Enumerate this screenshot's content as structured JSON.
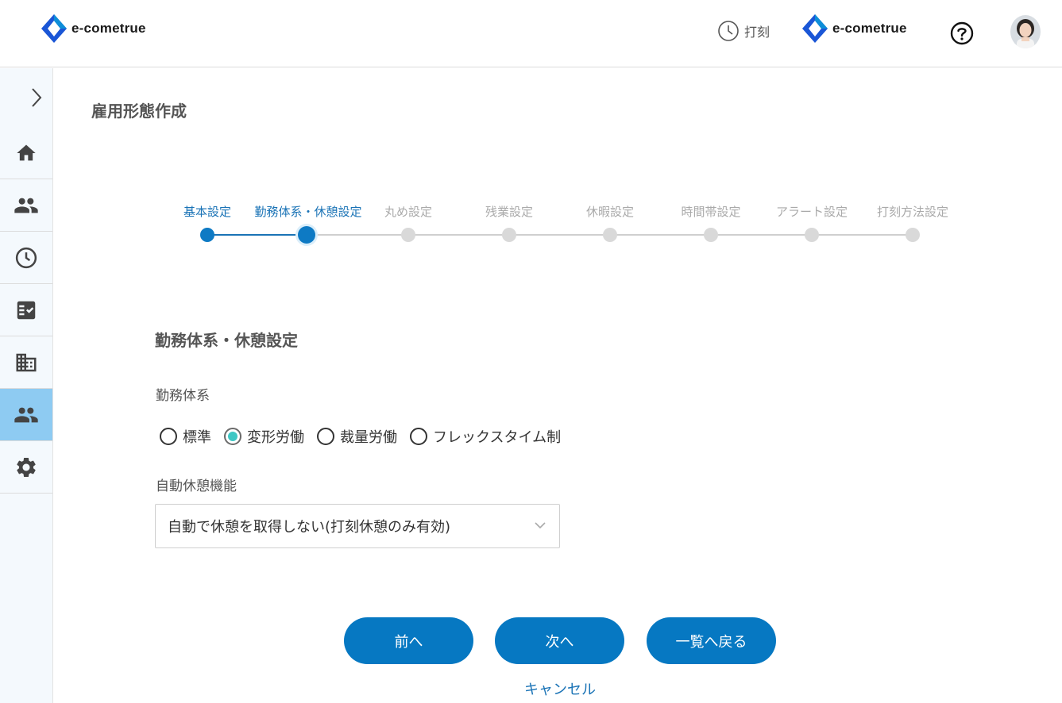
{
  "header": {
    "brand_left": "e-cometrue",
    "brand_right": "e-cometrue",
    "punch_label": "打刻",
    "icons": [
      "clock-icon",
      "help-icon",
      "avatar"
    ],
    "brand_colors": [
      "#1a56d6",
      "#0d8ed8"
    ]
  },
  "sidebar": {
    "items": [
      {
        "name": "home",
        "icon": "home-icon",
        "active": false
      },
      {
        "name": "users",
        "icon": "people-icon",
        "active": false
      },
      {
        "name": "time",
        "icon": "clock-icon",
        "active": false
      },
      {
        "name": "approval",
        "icon": "checklist-icon",
        "active": false
      },
      {
        "name": "organization",
        "icon": "building-icon",
        "active": false
      },
      {
        "name": "employment",
        "icon": "people-icon",
        "active": true
      },
      {
        "name": "settings",
        "icon": "gear-icon",
        "active": false
      }
    ],
    "active_color": "#8ecbf2"
  },
  "page": {
    "title": "雇用形態作成"
  },
  "stepper": {
    "steps": [
      {
        "label": "基本設定",
        "state": "done"
      },
      {
        "label": "勤務体系・休憩設定",
        "state": "current"
      },
      {
        "label": "丸め設定",
        "state": "todo"
      },
      {
        "label": "残業設定",
        "state": "todo"
      },
      {
        "label": "休暇設定",
        "state": "todo"
      },
      {
        "label": "時間帯設定",
        "state": "todo"
      },
      {
        "label": "アラート設定",
        "state": "todo"
      },
      {
        "label": "打刻方法設定",
        "state": "todo"
      }
    ],
    "accent": "#0e7ac4"
  },
  "form": {
    "section_title": "勤務体系・休憩設定",
    "work_system_label": "勤務体系",
    "work_system_options": [
      {
        "label": "標準",
        "checked": false
      },
      {
        "label": "変形労働",
        "checked": true
      },
      {
        "label": "裁量労働",
        "checked": false
      },
      {
        "label": "フレックスタイム制",
        "checked": false
      }
    ],
    "auto_break_label": "自動休憩機能",
    "auto_break_value": "自動で休憩を取得しない(打刻休憩のみ有効)"
  },
  "actions": {
    "prev": "前へ",
    "next": "次へ",
    "back_to_list": "一覧へ戻る",
    "cancel": "キャンセル",
    "button_color": "#0678c2"
  }
}
